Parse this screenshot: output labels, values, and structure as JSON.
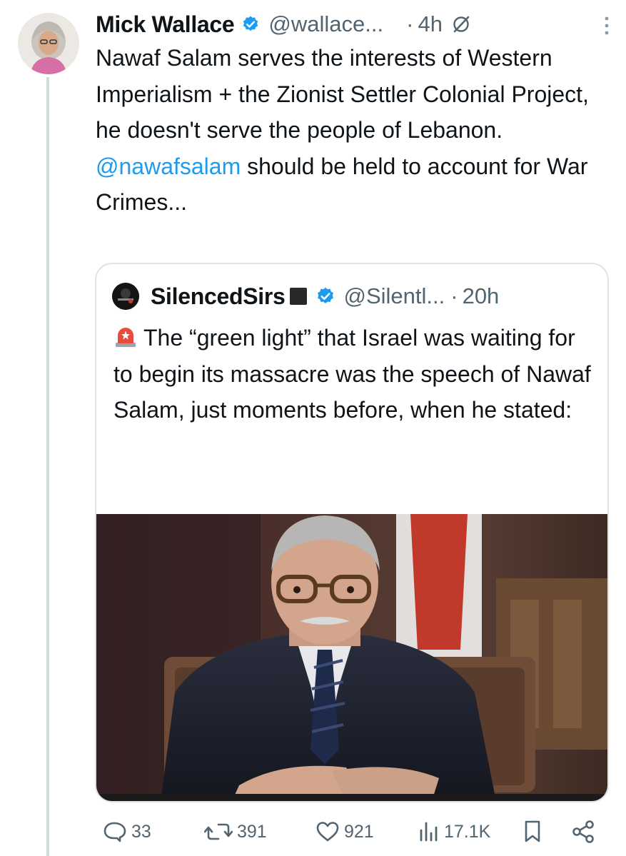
{
  "tweet": {
    "author_name": "Mick Wallace",
    "author_handle": "@wallace...",
    "dot": "·",
    "time": "4h",
    "text_before_mention": "Nawaf Salam serves the interests of Western Imperialism + the Zionist Settler Colonial Project, he doesn't serve the people of Lebanon. ",
    "mention": "@nawafsalam",
    "text_after_mention": " should be held to account for War Crimes..."
  },
  "quote": {
    "author_name": "SilencedSirs",
    "author_handle": "@Silentl...",
    "dot": "·",
    "time": "20h",
    "text": "The “green light” that Israel was waiting for to begin its massacre was the speech of Nawaf Salam, just moments before, when he stated:",
    "ellipsis": "..."
  },
  "actions": {
    "replies": "33",
    "retweets": "391",
    "likes": "921",
    "views": "17.1K"
  },
  "colors": {
    "verified": "#1d9bf0",
    "mention": "#1d9bf0",
    "muted": "#536471",
    "border": "#dfe3e6"
  },
  "icons": {
    "reply": "speech-bubble",
    "retweet": "retweet-arrows",
    "like": "heart",
    "views": "bar-chart",
    "bookmark": "bookmark",
    "share": "share-nodes"
  }
}
